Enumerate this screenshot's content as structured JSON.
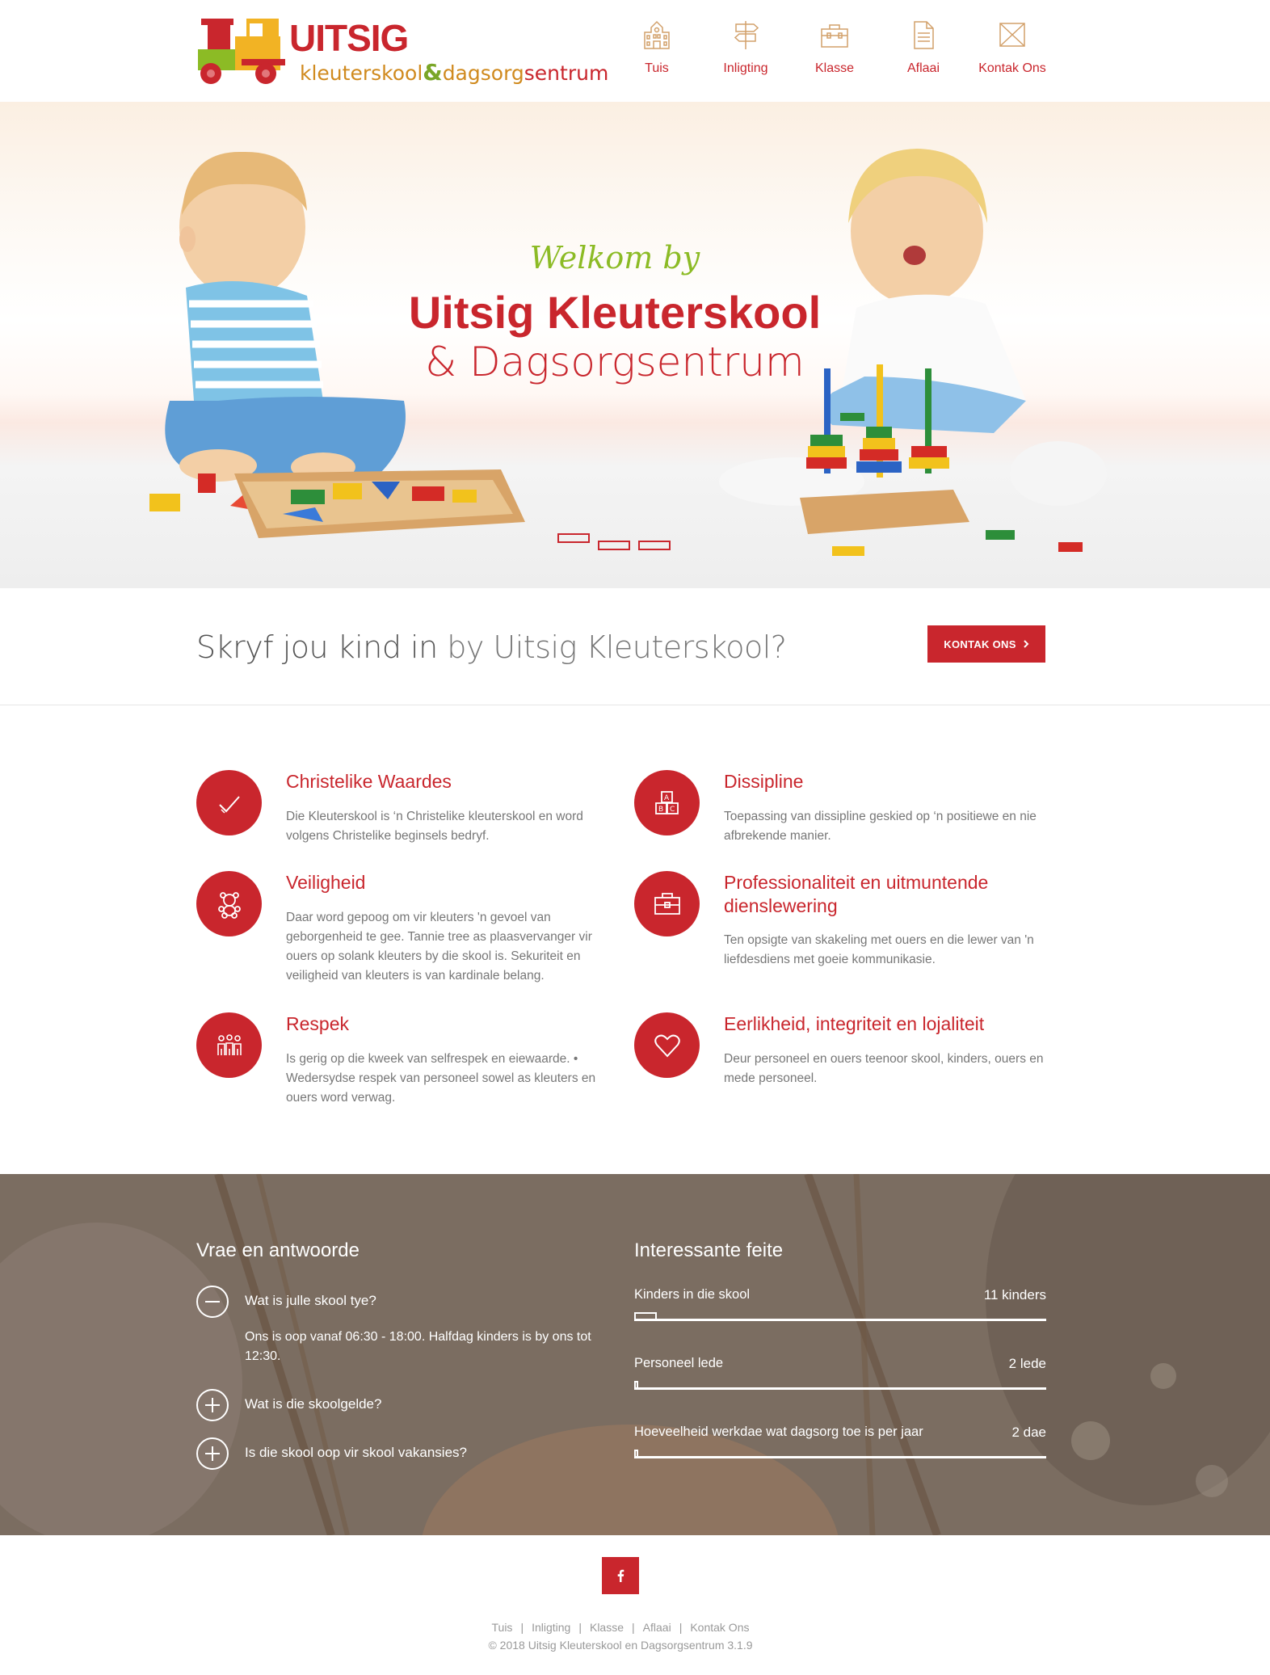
{
  "logo": {
    "title": "UITSIG",
    "sub_part1": "kleuterskool",
    "amp": "&",
    "sub_part2": "dagsorg",
    "sub_part3": "sentrum"
  },
  "nav": [
    {
      "label": "Tuis",
      "icon": "school-icon"
    },
    {
      "label": "Inligting",
      "icon": "signpost-icon"
    },
    {
      "label": "Klasse",
      "icon": "toolbox-icon"
    },
    {
      "label": "Aflaai",
      "icon": "document-icon"
    },
    {
      "label": "Kontak Ons",
      "icon": "envelope-icon"
    }
  ],
  "hero": {
    "welcome": "Welkom by",
    "title": "Uitsig Kleuterskool",
    "subtitle": "& Dagsorgsentrum",
    "slides_count": 3,
    "active_slide": 1
  },
  "cta": {
    "strong": "Skryf jou kind in",
    "light": " by Uitsig Kleuterskool?",
    "button": "KONTAK ONS",
    "button_icon": "chevron-right-icon"
  },
  "features": [
    {
      "icon": "checkmark-icon",
      "title": "Christelike Waardes",
      "text": "Die Kleuterskool is ‘n Christelike kleuterskool en word volgens Christelike beginsels bedryf."
    },
    {
      "icon": "blocks-icon",
      "title": "Dissipline",
      "text": "Toepassing van dissipline geskied op ‘n positiewe en nie afbrekende manier."
    },
    {
      "icon": "teddy-bear-icon",
      "title": "Veiligheid",
      "text": "Daar word gepoog om vir kleuters 'n gevoel van geborgenheid te gee. Tannie tree as plaasvervanger vir ouers op solank kleuters by die skool is. Sekuriteit en veiligheid van kleuters is van kardinale belang."
    },
    {
      "icon": "briefcase-icon",
      "title": "Professionaliteit en uitmuntende dienslewering",
      "text": "Ten opsigte van skakeling met ouers en die lewer van 'n liefdesdiens met goeie kommunikasie."
    },
    {
      "icon": "people-icon",
      "title": "Respek",
      "text": "Is gerig op die kweek van selfrespek en eiewaarde. • Wedersydse respek van personeel sowel as kleuters en ouers word verwag."
    },
    {
      "icon": "heart-icon",
      "title": "Eerlikheid, integriteit en lojaliteit",
      "text": "Deur personeel en ouers teenoor skool, kinders, ouers en mede personeel."
    }
  ],
  "faq": {
    "heading": "Vrae en antwoorde",
    "items": [
      {
        "question": "Wat is julle skool tye?",
        "answer": "Ons is oop vanaf 06:30 - 18:00. Halfdag kinders is by ons tot 12:30.",
        "expanded": true
      },
      {
        "question": "Wat is die skoolgelde?",
        "expanded": false
      },
      {
        "question": "Is die skool oop vir skool vakansies?",
        "expanded": false
      }
    ]
  },
  "facts": {
    "heading": "Interessante feite",
    "items": [
      {
        "label": "Kinders in die skool",
        "value": "11 kinders",
        "fraction": 0.055
      },
      {
        "label": "Personeel lede",
        "value": "2 lede",
        "fraction": 0.01
      },
      {
        "label": "Hoeveelheid werkdae wat dagsorg toe is per jaar",
        "value": "2 dae",
        "fraction": 0.01
      }
    ]
  },
  "footer": {
    "social_icon": "facebook-icon",
    "links": [
      "Tuis",
      "Inligting",
      "Klasse",
      "Aflaai",
      "Kontak Ons"
    ],
    "separator": "|",
    "copyright": "© 2018 Uitsig Kleuterskool en Dagsorgsentrum 3.1.9"
  },
  "colors": {
    "brand_red": "#c9262d",
    "brand_green": "#8cbb25",
    "brand_orange": "#d08a1e"
  }
}
